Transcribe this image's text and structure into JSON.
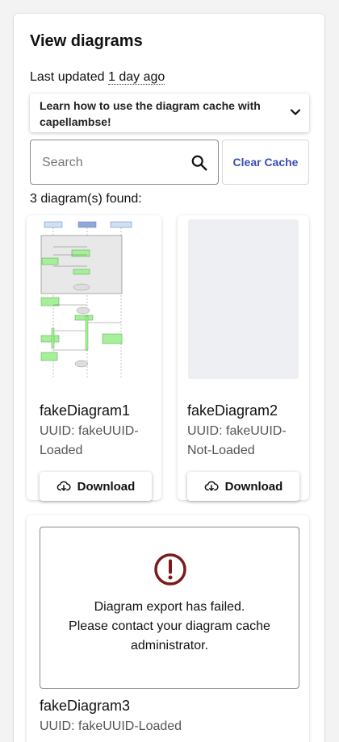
{
  "header": {
    "title": "View diagrams",
    "last_updated_prefix": "Last updated",
    "last_updated_value": "1 day ago"
  },
  "howto": {
    "label_line1": "Learn how to use the diagram cache with",
    "label_line2": "capellambse!",
    "icon": "chevron-down-icon"
  },
  "search": {
    "placeholder": "Search",
    "value": "",
    "icon": "search-icon"
  },
  "clear_cache_label": "Clear Cache",
  "results": {
    "count_text": "3 diagram(s) found:"
  },
  "diagrams": [
    {
      "name": "fakeDiagram1",
      "uuid_line1": "UUID: fakeUUID-",
      "uuid_line2": "Loaded",
      "download_label": "Download"
    },
    {
      "name": "fakeDiagram2",
      "uuid_line1": "UUID: fakeUUID-",
      "uuid_line2": "Not-Loaded",
      "download_label": "Download"
    },
    {
      "name": "fakeDiagram3",
      "uuid_line1": "UUID: fakeUUID-Loaded",
      "error_line1": "Diagram export has failed.",
      "error_line2": "Please contact your diagram cache",
      "error_line3": "administrator."
    }
  ],
  "colors": {
    "accent": "#3b4fb3",
    "error": "#7a1c1c",
    "placeholder_bg": "#eeeff3"
  }
}
